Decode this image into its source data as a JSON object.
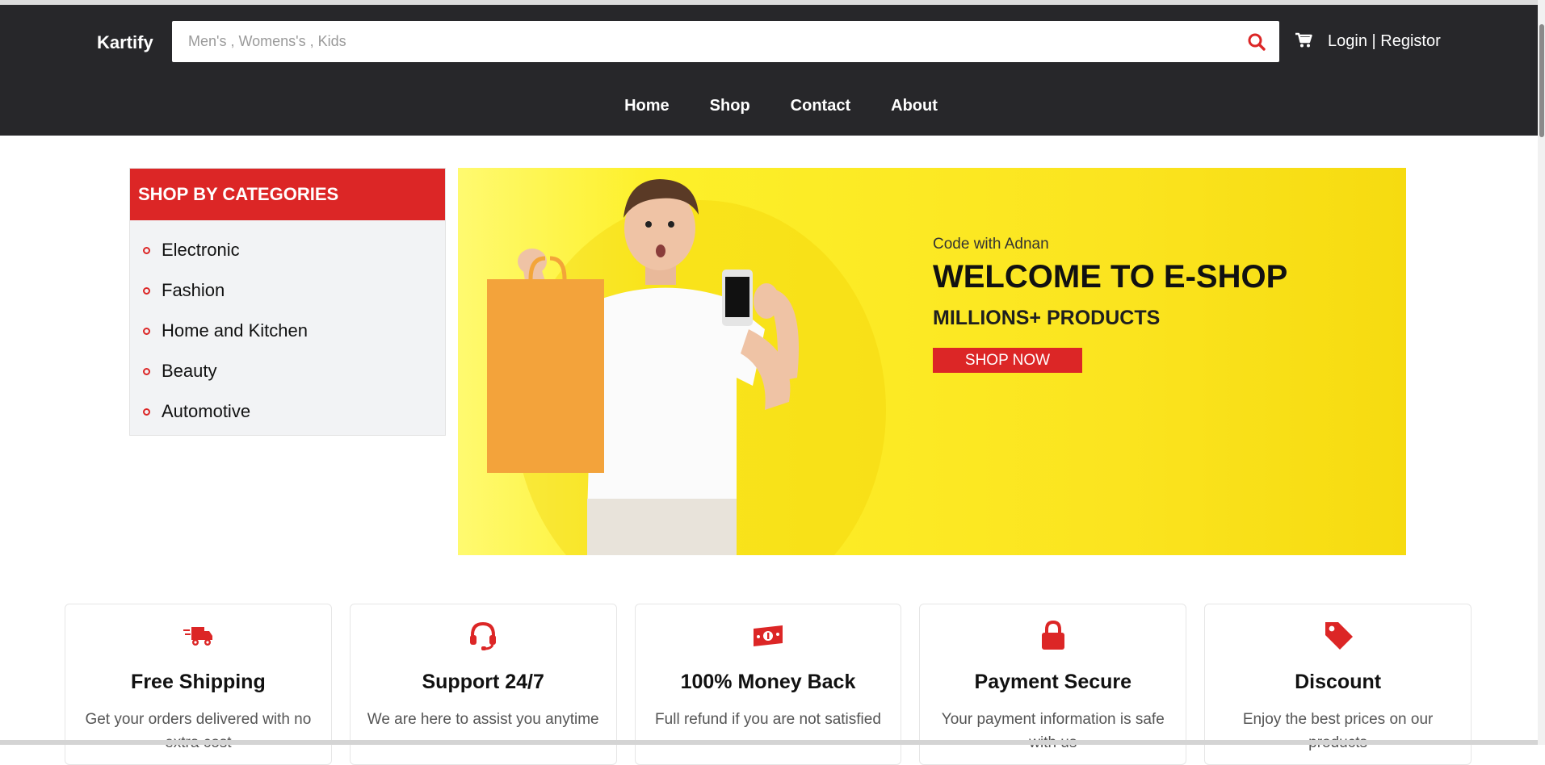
{
  "header": {
    "brand": "Kartify",
    "search_placeholder": "Men's , Womens's , Kids",
    "auth_login": "Login",
    "auth_sep": " | ",
    "auth_register": "Registor",
    "nav": [
      "Home",
      "Shop",
      "Contact",
      "About"
    ]
  },
  "categories": {
    "title": "SHOP BY CATEGORIES",
    "items": [
      "Electronic",
      "Fashion",
      "Home and Kitchen",
      "Beauty",
      "Automotive"
    ]
  },
  "banner": {
    "subtitle": "Code with Adnan",
    "title": "WELCOME TO E-SHOP",
    "tagline": "MILLIONS+ PRODUCTS",
    "cta": "SHOP NOW"
  },
  "features": [
    {
      "icon": "truck-icon",
      "title": "Free Shipping",
      "text": "Get your orders delivered with no extra cost"
    },
    {
      "icon": "headset-icon",
      "title": "Support 24/7",
      "text": "We are here to assist you anytime"
    },
    {
      "icon": "money-icon",
      "title": "100% Money Back",
      "text": "Full refund if you are not satisfied"
    },
    {
      "icon": "lock-icon",
      "title": "Payment Secure",
      "text": "Your payment information is safe with us"
    },
    {
      "icon": "tag-icon",
      "title": "Discount",
      "text": "Enjoy the best prices on our products"
    }
  ],
  "colors": {
    "accent": "#dc2626",
    "header_bg": "#27272a",
    "banner_yellow": "#fbe41f"
  }
}
